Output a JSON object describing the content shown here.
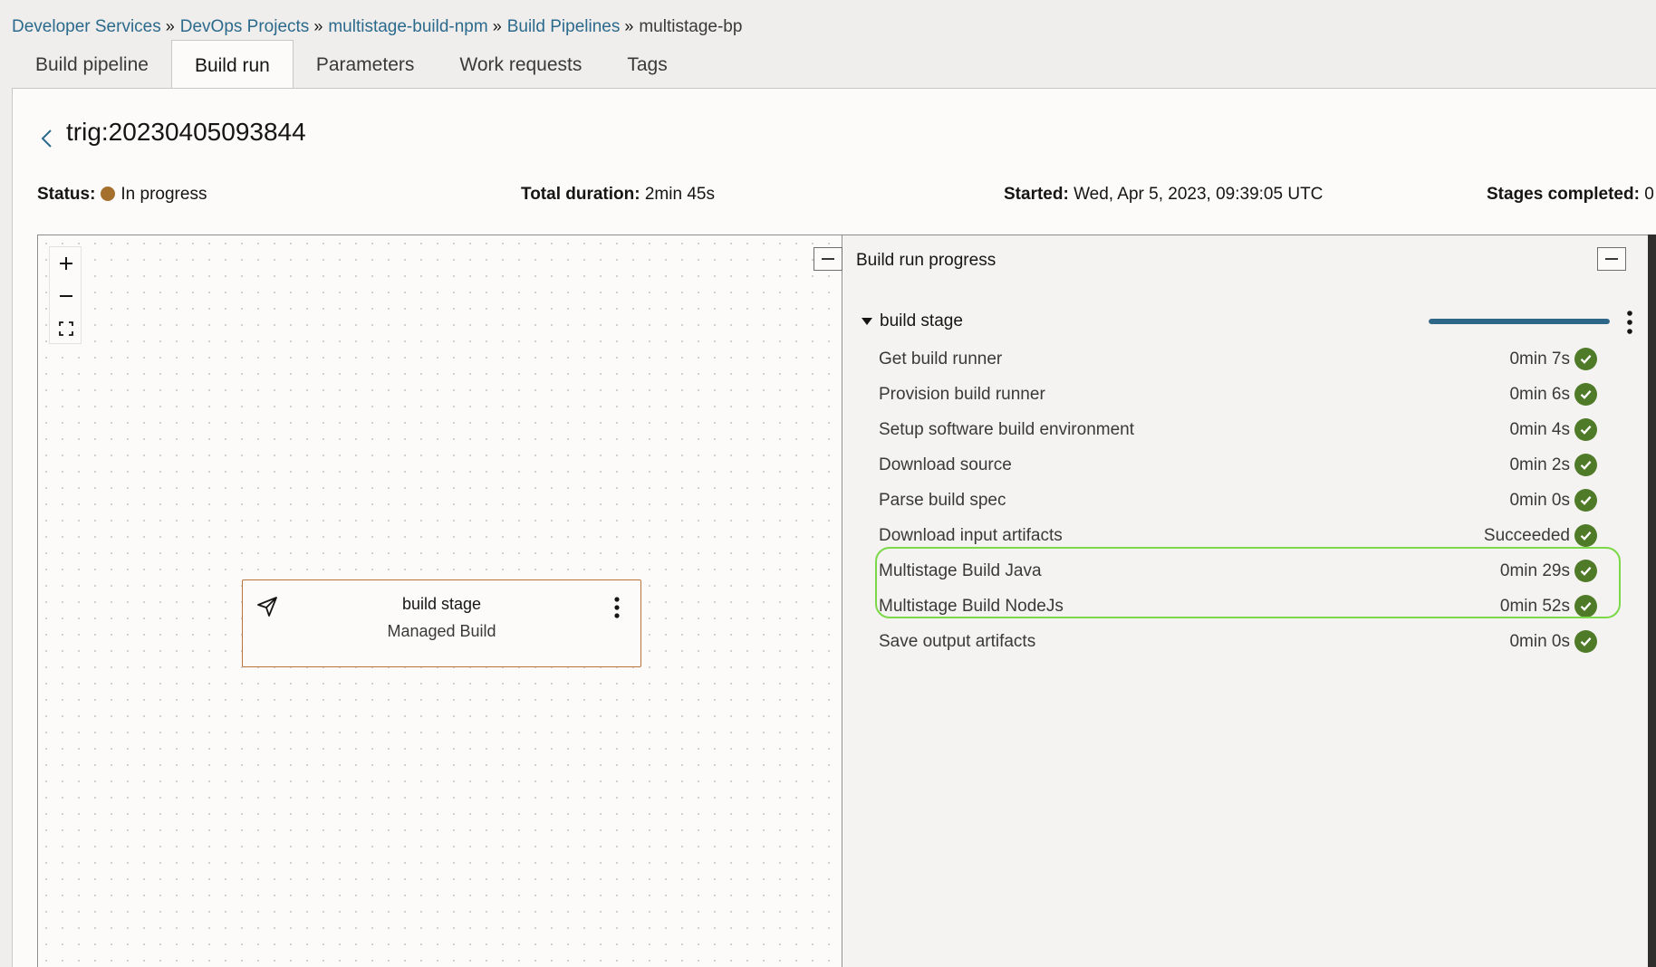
{
  "breadcrumb": {
    "items": [
      "Developer Services",
      "DevOps Projects",
      "multistage-build-npm",
      "Build Pipelines"
    ],
    "separator": "»",
    "current": "multistage-bp"
  },
  "tabs": [
    {
      "label": "Build pipeline",
      "active": false
    },
    {
      "label": "Build run",
      "active": true
    },
    {
      "label": "Parameters",
      "active": false
    },
    {
      "label": "Work requests",
      "active": false
    },
    {
      "label": "Tags",
      "active": false
    }
  ],
  "run": {
    "title": "trig:20230405093844",
    "status_label": "Status:",
    "status_value": "In progress",
    "status_color": "#a5702d",
    "duration_label": "Total duration:",
    "duration_value": "2min 45s",
    "started_label": "Started:",
    "started_value": "Wed, Apr 5, 2023, 09:39:05 UTC",
    "stages_label": "Stages completed:",
    "stages_value": "0"
  },
  "canvas": {
    "zoom_in_icon": "plus-icon",
    "zoom_out_icon": "minus-icon",
    "fit_icon": "expand-icon",
    "stage": {
      "name": "build stage",
      "type": "Managed Build",
      "icon": "paper-plane-icon"
    }
  },
  "progress": {
    "title": "Build run progress",
    "stage_name": "build stage",
    "stage_progress": 1.0,
    "accent": "#2e6687",
    "success_color": "#4f7a28",
    "highlight_color": "#7bd949",
    "steps": [
      {
        "label": "Get build runner",
        "duration": "0min 7s"
      },
      {
        "label": "Provision build runner",
        "duration": "0min 6s"
      },
      {
        "label": "Setup software build environment",
        "duration": "0min 4s"
      },
      {
        "label": "Download source",
        "duration": "0min 2s"
      },
      {
        "label": "Parse build spec",
        "duration": "0min 0s"
      },
      {
        "label": "Download input artifacts",
        "duration": "Succeeded"
      },
      {
        "label": "Multistage Build Java",
        "duration": "0min 29s"
      },
      {
        "label": "Multistage Build NodeJs",
        "duration": "0min 52s"
      },
      {
        "label": "Save output artifacts",
        "duration": "0min 0s"
      }
    ]
  }
}
